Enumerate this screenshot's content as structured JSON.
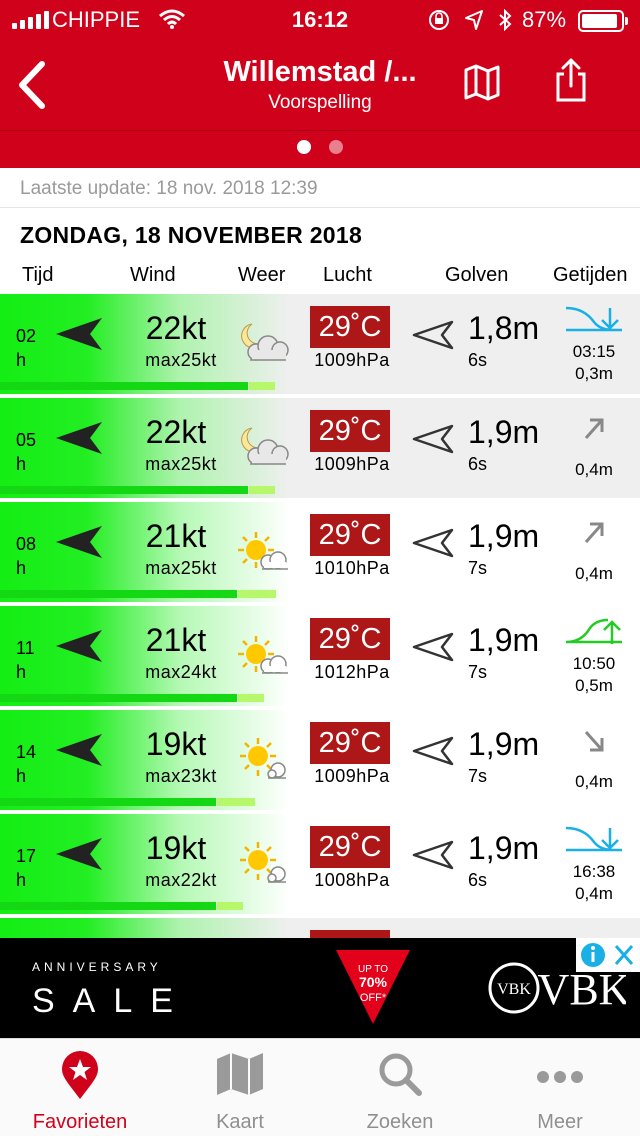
{
  "status_bar": {
    "carrier": "CHIPPIE",
    "time": "16:12",
    "battery": "87%"
  },
  "nav": {
    "title": "Willemstad /...",
    "subtitle": "Voorspelling"
  },
  "page_indicator": {
    "pages": 2,
    "active": 0
  },
  "last_update": "Laatste update: 18 nov. 2018 12:39",
  "date_heading": "ZONDAG, 18 NOVEMBER 2018",
  "columns": [
    "Tijd",
    "Wind",
    "Weer",
    "Lucht",
    "Golven",
    "Getijden"
  ],
  "rows": [
    {
      "hour": "02",
      "unit": "h",
      "wind": "22kt",
      "max": "max25kt",
      "weather_icon": "night-moon-cloud-icon",
      "temp": "29˚C",
      "pressure": "1009hPa",
      "wave": "1,8m",
      "period": "6s",
      "tide_icon": "tide-falling-icon",
      "tide_time": "03:15",
      "tide_height": "0,3m",
      "wind_level": 0.93,
      "gust_level": 0.09,
      "shaded": true
    },
    {
      "hour": "05",
      "unit": "h",
      "wind": "22kt",
      "max": "max25kt",
      "weather_icon": "night-moon-cloud-icon",
      "temp": "29˚C",
      "pressure": "1009hPa",
      "wave": "1,9m",
      "period": "6s",
      "tide_icon": "arrow-up-right-icon",
      "tide_time": "",
      "tide_height": "0,4m",
      "wind_level": 0.93,
      "gust_level": 0.09,
      "shaded": true
    },
    {
      "hour": "08",
      "unit": "h",
      "wind": "21kt",
      "max": "max25kt",
      "weather_icon": "sun-cloud-icon",
      "temp": "29˚C",
      "pressure": "1010hPa",
      "wave": "1,9m",
      "period": "7s",
      "tide_icon": "arrow-up-right-icon",
      "tide_time": "",
      "tide_height": "0,4m",
      "wind_level": 0.89,
      "gust_level": 0.13,
      "shaded": false
    },
    {
      "hour": "11",
      "unit": "h",
      "wind": "21kt",
      "max": "max24kt",
      "weather_icon": "sun-cloud-icon",
      "temp": "29˚C",
      "pressure": "1012hPa",
      "wave": "1,9m",
      "period": "7s",
      "tide_icon": "tide-rising-icon",
      "tide_time": "10:50",
      "tide_height": "0,5m",
      "wind_level": 0.89,
      "gust_level": 0.09,
      "shaded": false
    },
    {
      "hour": "14",
      "unit": "h",
      "wind": "19kt",
      "max": "max23kt",
      "weather_icon": "sun-small-cloud-icon",
      "temp": "29˚C",
      "pressure": "1009hPa",
      "wave": "1,9m",
      "period": "7s",
      "tide_icon": "arrow-down-right-icon",
      "tide_time": "",
      "tide_height": "0,4m",
      "wind_level": 0.81,
      "gust_level": 0.13,
      "shaded": false
    },
    {
      "hour": "17",
      "unit": "h",
      "wind": "19kt",
      "max": "max22kt",
      "weather_icon": "sun-small-cloud-icon",
      "temp": "29˚C",
      "pressure": "1008hPa",
      "wave": "1,9m",
      "period": "6s",
      "tide_icon": "tide-falling-icon",
      "tide_time": "16:38",
      "tide_height": "0,4m",
      "wind_level": 0.81,
      "gust_level": 0.09,
      "shaded": false
    }
  ],
  "ad": {
    "line1": "ANNIVERSARY",
    "line2": "SALE",
    "badge_line1": "UP TO",
    "badge_line2": "70%",
    "badge_line3": "OFF*",
    "brand": "VBK"
  },
  "tabs": [
    {
      "label": "Favorieten",
      "icon": "star-pin-icon",
      "active": true
    },
    {
      "label": "Kaart",
      "icon": "map-icon",
      "active": false
    },
    {
      "label": "Zoeken",
      "icon": "search-icon",
      "active": false
    },
    {
      "label": "Meer",
      "icon": "more-dots-icon",
      "active": false
    }
  ],
  "colors": {
    "header_red": "#d0021b",
    "temp_red": "#ae1717",
    "wind_green": "#14ee14",
    "gust_green": "#b6f76b",
    "tide_blue": "#1ab0e6",
    "tide_green": "#22cc22"
  }
}
